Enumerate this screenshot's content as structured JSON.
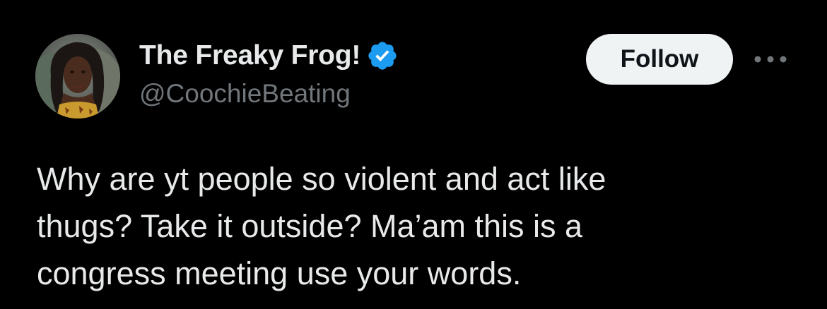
{
  "tweet": {
    "author": {
      "display_name": "The Freaky Frog!",
      "handle": "@CoochieBeating",
      "verified": true,
      "avatar_icon": "profile-photo"
    },
    "follow_label": "Follow",
    "more_icon": "more-options-icon",
    "text": "Why are yt people so violent and act like\nthugs? Take it outside? Ma’am this is a\ncongress meeting use your words."
  },
  "colors": {
    "background": "#000000",
    "primary_text": "#e7e9ea",
    "secondary_text": "#71767b",
    "verified_blue": "#1d9bf0",
    "follow_button_bg": "#eff3f4",
    "follow_button_text": "#0f1419"
  }
}
